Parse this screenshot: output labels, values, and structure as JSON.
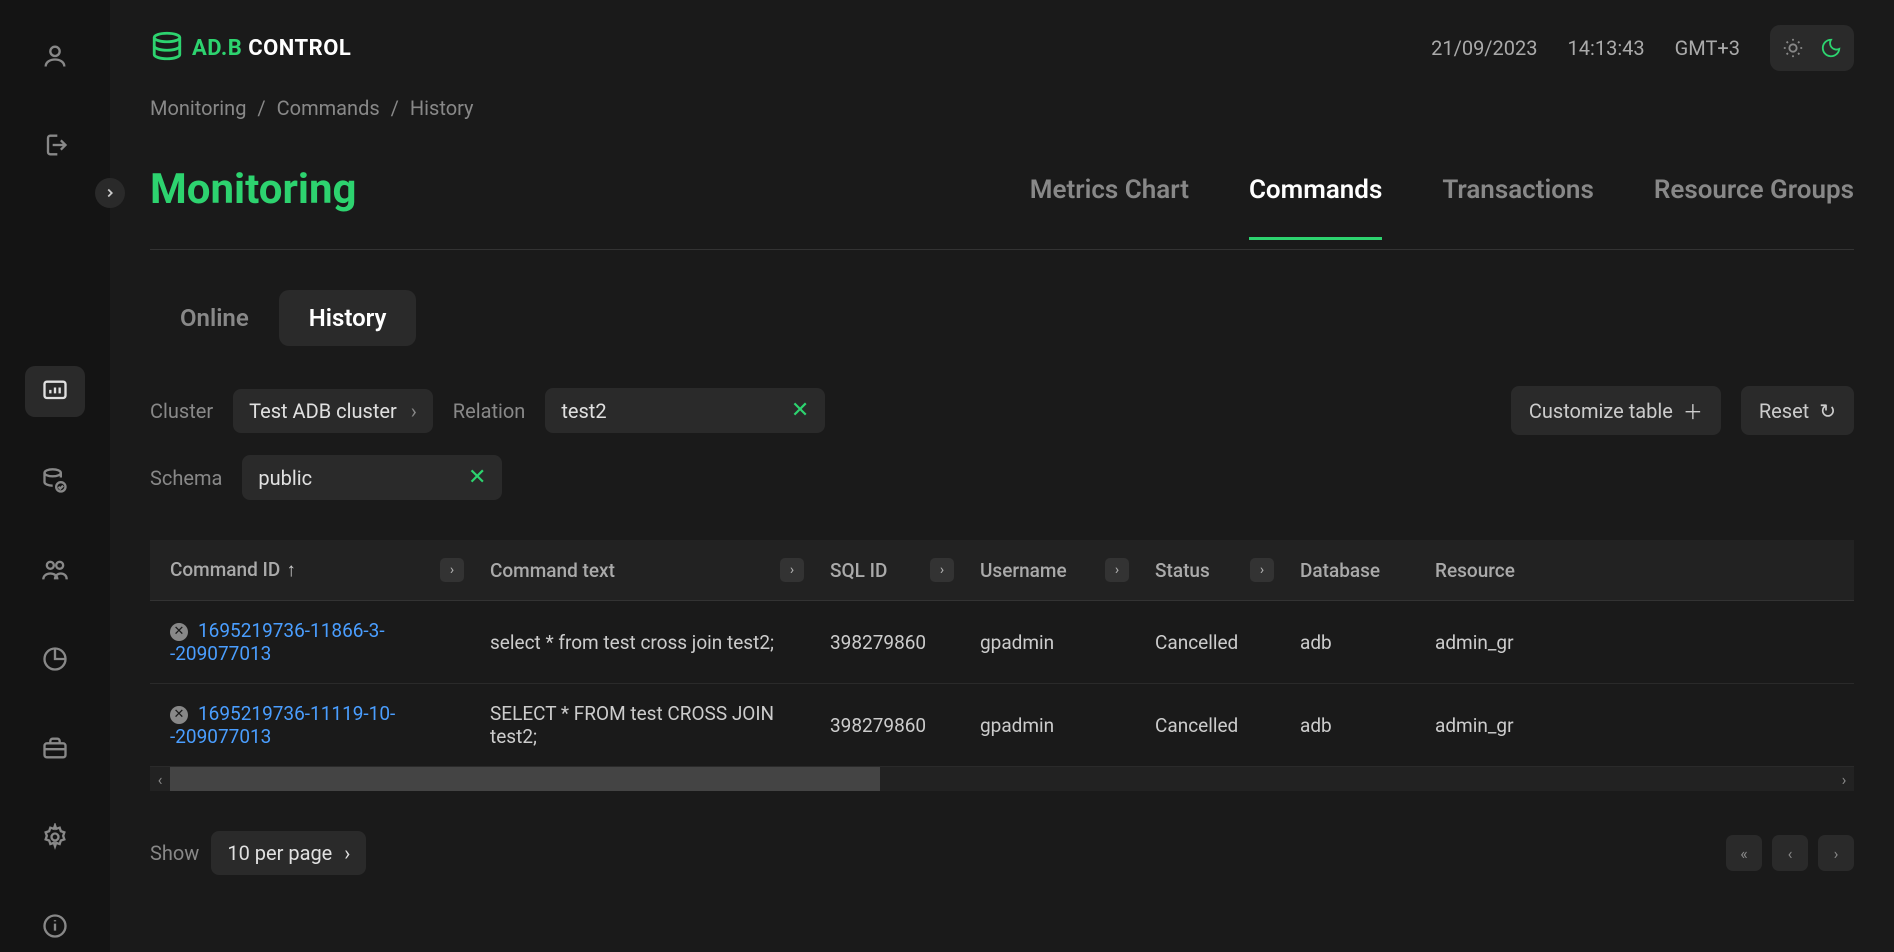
{
  "header": {
    "brand_a": "AD.B",
    "brand_b": " CONTROL",
    "date": "21/09/2023",
    "time": "14:13:43",
    "tz": "GMT+3"
  },
  "breadcrumb": {
    "a": "Monitoring",
    "b": "Commands",
    "c": "History"
  },
  "page_title": "Monitoring",
  "tabs": {
    "metrics": "Metrics Chart",
    "commands": "Commands",
    "transactions": "Transactions",
    "resource": "Resource Groups"
  },
  "subtabs": {
    "online": "Online",
    "history": "History"
  },
  "filters": {
    "cluster_label": "Cluster",
    "cluster_value": "Test ADB cluster",
    "relation_label": "Relation",
    "relation_value": "test2",
    "schema_label": "Schema",
    "schema_value": "public",
    "customize": "Customize table",
    "reset": "Reset"
  },
  "columns": {
    "cmd_id": "Command ID",
    "cmd_text": "Command text",
    "sql_id": "SQL ID",
    "username": "Username",
    "status": "Status",
    "database": "Database",
    "resource": "Resource"
  },
  "rows": [
    {
      "id": "1695219736-11866-3--209077013",
      "text": "select * from test cross join test2;",
      "sql": "398279860",
      "user": "gpadmin",
      "status": "Cancelled",
      "db": "adb",
      "rg": "admin_gr"
    },
    {
      "id": "1695219736-11119-10--209077013",
      "text": "SELECT * FROM test CROSS JOIN test2;",
      "sql": "398279860",
      "user": "gpadmin",
      "status": "Cancelled",
      "db": "adb",
      "rg": "admin_gr"
    }
  ],
  "pager": {
    "show": "Show",
    "perpage": "10 per page"
  }
}
